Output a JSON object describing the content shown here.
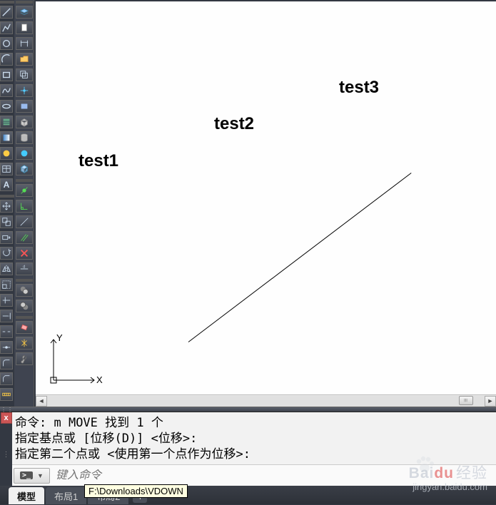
{
  "canvas": {
    "texts": [
      "test1",
      "test2",
      "test3"
    ]
  },
  "ucs": {
    "x_label": "X",
    "y_label": "Y"
  },
  "command_history": {
    "line1_prefix": "命令: ",
    "line1_cmd": "m MOVE ",
    "line1_result": "找到 1 个",
    "line2": "指定基点或 [位移(D)] <位移>:",
    "line3": "指定第二个点或 <使用第一个点作为位移>:"
  },
  "command_input": {
    "prompt_icon": ">_",
    "placeholder": "键入命令"
  },
  "tabs": {
    "model": "模型",
    "layout1": "布局1",
    "layout2": "布局2",
    "add": "+"
  },
  "tooltip": "F:\\Downloads\\VDOWN",
  "close_x": "x",
  "scroll_arrows": {
    "left": "◄",
    "right": "►"
  },
  "watermark": {
    "brand_a": "Bai",
    "brand_b": "du",
    "brand_c": "经验",
    "url": "jingyan.baidu.com"
  }
}
